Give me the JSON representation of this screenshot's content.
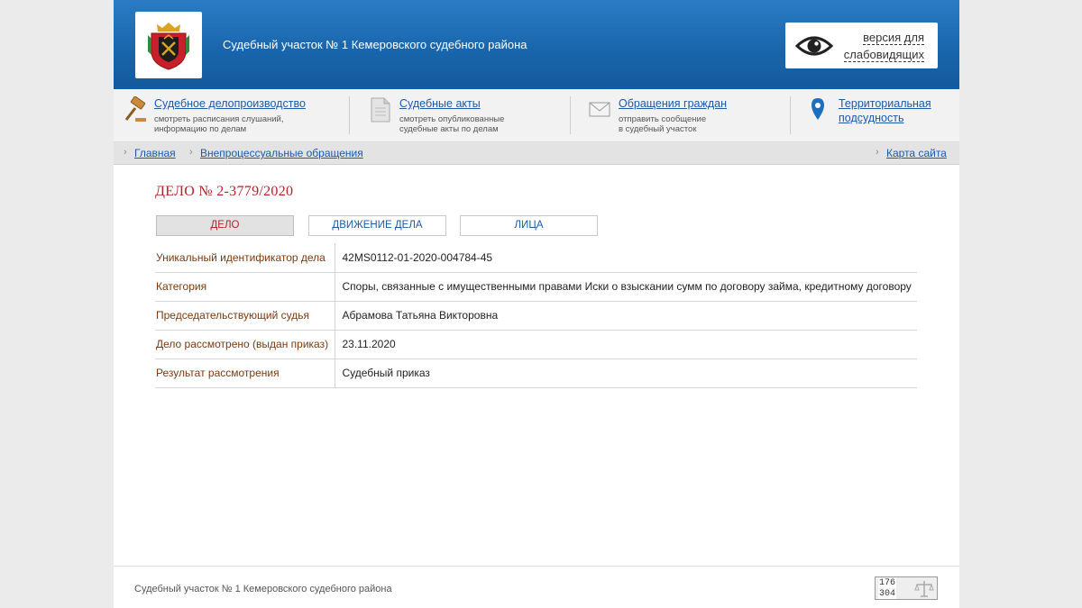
{
  "header": {
    "title": "Судебный участок № 1 Кемеровского судебного района",
    "vision": {
      "line1": "версия для",
      "line2": "слабовидящих"
    }
  },
  "services": [
    {
      "label": "Судебное делопроизводство",
      "sub1": "смотреть расписания слушаний,",
      "sub2": "информацию по делам",
      "icon": "gavel-icon"
    },
    {
      "label": "Судебные акты",
      "sub1": "смотреть опубликованные",
      "sub2": "судебные акты по делам",
      "icon": "document-icon"
    },
    {
      "label": "Обращения граждан",
      "sub1": "отправить сообщение",
      "sub2": "в судебный участок",
      "icon": "envelope-icon"
    },
    {
      "label1": "Территориальная",
      "label2": "подсудность",
      "icon": "map-pin-icon"
    }
  ],
  "breadcrumb": {
    "home": "Главная",
    "section": "Внепроцессуальные обращения",
    "sitemap": "Карта сайта"
  },
  "case": {
    "title": "ДЕЛО № 2-3779/2020",
    "tabs": [
      "ДЕЛО",
      "ДВИЖЕНИЕ ДЕЛА",
      "ЛИЦА"
    ],
    "rows": [
      {
        "k": "Уникальный идентификатор дела",
        "v": "42MS0112-01-2020-004784-45"
      },
      {
        "k": "Категория",
        "v": "Споры, связанные с имущественными правами Иски о взыскании сумм по договору займа, кредитному договору"
      },
      {
        "k": "Председательствующий судья",
        "v": "Абрамова Татьяна Викторовна"
      },
      {
        "k": "Дело рассмотрено (выдан приказ)",
        "v": "23.11.2020"
      },
      {
        "k": "Результат рассмотрения",
        "v": "Судебный приказ"
      }
    ]
  },
  "footer": {
    "text": "Судебный участок № 1 Кемеровского судебного района",
    "counter": {
      "top": "176",
      "bottom": "304"
    }
  },
  "colors": {
    "header_blue": "#1966ad",
    "link": "#1c5aa8",
    "accent_red": "#b5222b"
  }
}
